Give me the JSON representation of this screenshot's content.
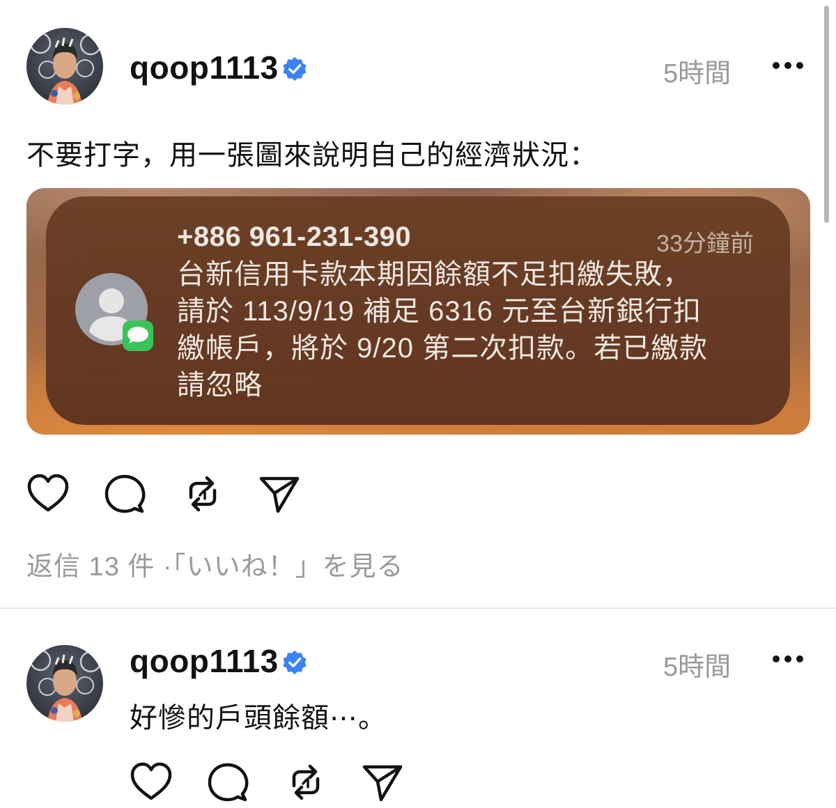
{
  "posts": [
    {
      "username": "qoop1113",
      "time": "5時間",
      "text": "不要打字，用一張圖來說明自己的經濟狀況："
    },
    {
      "username": "qoop1113",
      "time": "5時間",
      "text": "好慘的戶頭餘額⋯。"
    }
  ],
  "notification": {
    "sender": "+886 961-231-390",
    "time_ago": "33分鐘前",
    "lines": [
      "台新信用卡款本期因餘額不足扣繳失敗，",
      "請於 113/9/19 補足 6316 元至台新銀行扣",
      "繳帳戶，將於 9/20 第二次扣款。若已繳款",
      "請忽略"
    ]
  },
  "meta": "返信 13 件 ·「いいね！」を見る",
  "icons": {
    "verified": "verified-badge-icon",
    "more": "more-icon",
    "like": "heart-icon",
    "reply": "comment-icon",
    "repost": "repost-icon",
    "share": "send-icon",
    "contact": "contact-avatar-icon",
    "messages": "messages-app-icon"
  },
  "colors": {
    "verified_blue": "#3b82f6",
    "muted_text": "#9a9a9a",
    "messages_green": "#35c759"
  }
}
